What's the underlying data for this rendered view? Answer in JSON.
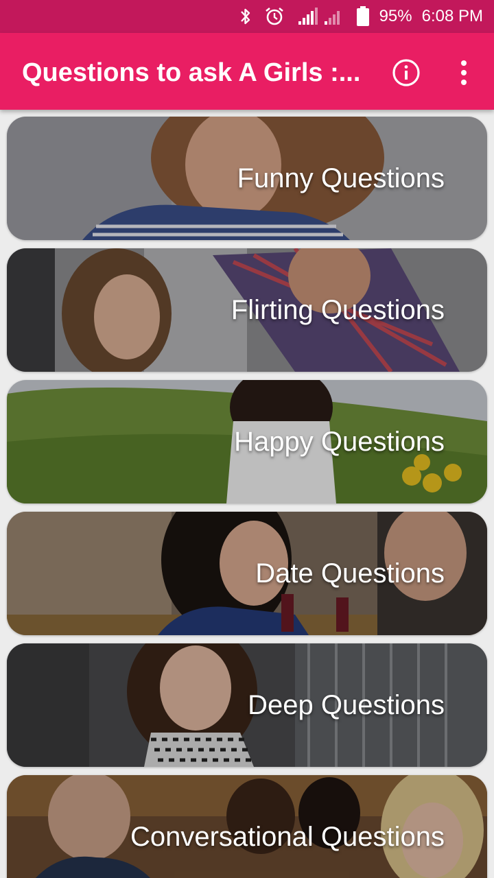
{
  "status_bar": {
    "icons": [
      "bluetooth-icon",
      "alarm-icon",
      "signal-icon",
      "signal-weak-icon",
      "battery-icon"
    ],
    "battery": "95%",
    "time": "6:08 PM"
  },
  "app_bar": {
    "title": "Questions to ask A Girls :...",
    "actions": [
      "info-icon",
      "overflow-menu-icon"
    ]
  },
  "categories": [
    {
      "label": "Funny Questions"
    },
    {
      "label": "Flirting Questions"
    },
    {
      "label": "Happy Questions"
    },
    {
      "label": "Date Questions"
    },
    {
      "label": "Deep Questions"
    },
    {
      "label": "Conversational Questions"
    }
  ],
  "colors": {
    "status_bar": "#c2185b",
    "app_bar": "#e91e63",
    "background": "#ececec",
    "text_on_primary": "#ffffff"
  }
}
